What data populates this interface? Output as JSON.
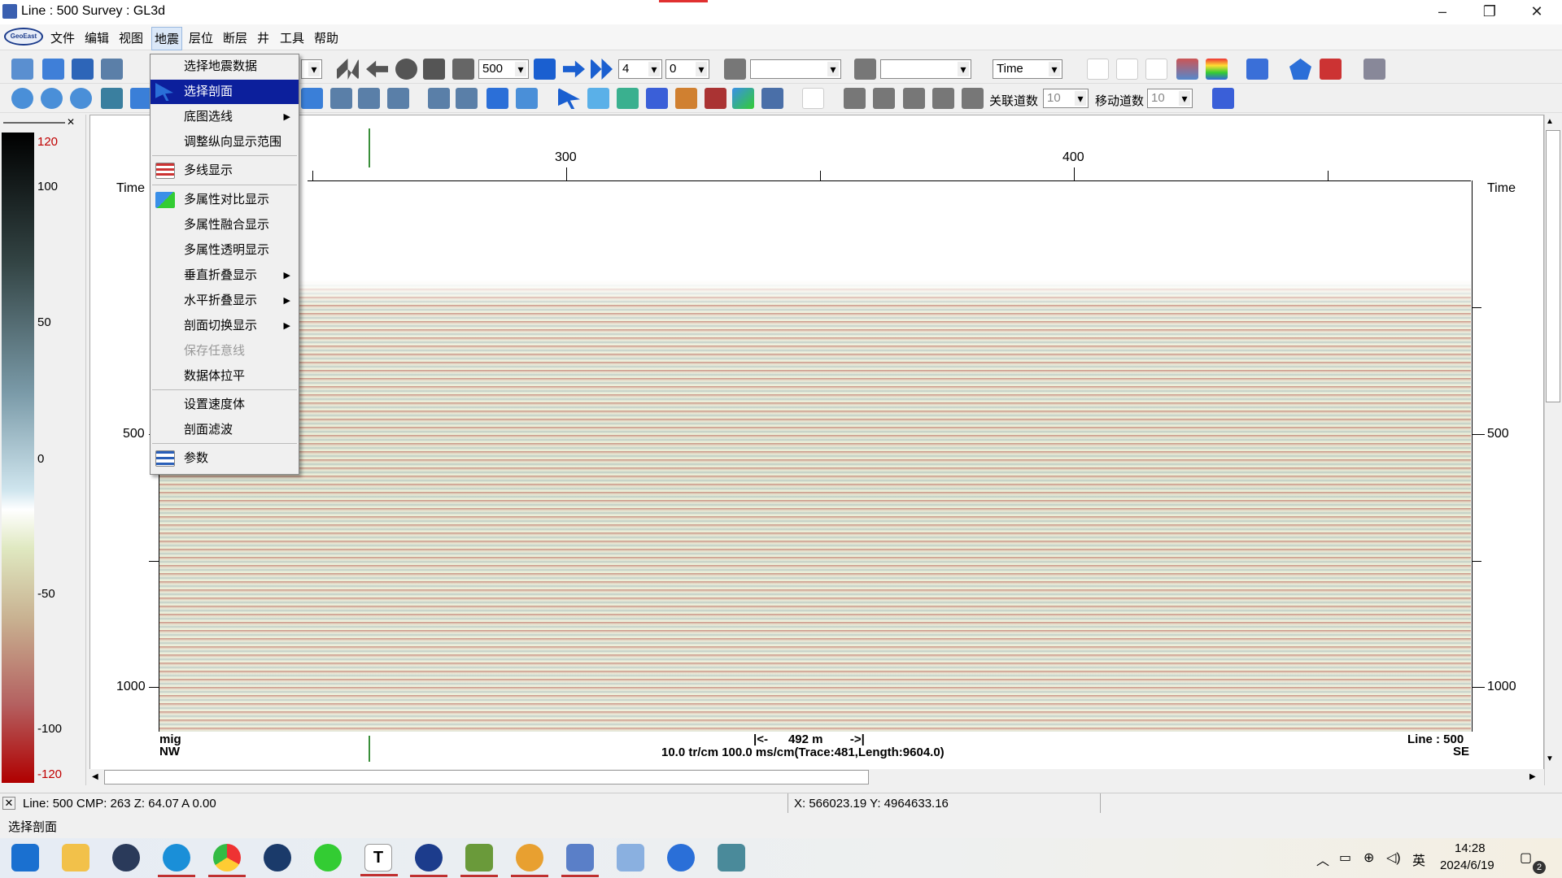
{
  "window": {
    "title": "Line : 500  Survey : GL3d"
  },
  "menu": {
    "logo_text": "GeoEast",
    "items": [
      "文件",
      "编辑",
      "视图",
      "地震",
      "层位",
      "断层",
      "井",
      "工具",
      "帮助"
    ],
    "active": "地震"
  },
  "dropdown": {
    "items": [
      {
        "label": "选择地震数据",
        "state": "normal",
        "submenu": false
      },
      {
        "label": "选择剖面",
        "state": "selected",
        "submenu": false
      },
      {
        "label": "底图选线",
        "state": "normal",
        "submenu": true
      },
      {
        "label": "调整纵向显示范围",
        "state": "normal",
        "submenu": false
      },
      {
        "label": "多线显示",
        "state": "normal",
        "submenu": false
      },
      {
        "label": "多属性对比显示",
        "state": "normal",
        "submenu": false
      },
      {
        "label": "多属性融合显示",
        "state": "normal",
        "submenu": false
      },
      {
        "label": "多属性透明显示",
        "state": "normal",
        "submenu": false
      },
      {
        "label": "垂直折叠显示",
        "state": "normal",
        "submenu": true
      },
      {
        "label": "水平折叠显示",
        "state": "normal",
        "submenu": true
      },
      {
        "label": "剖面切换显示",
        "state": "normal",
        "submenu": true
      },
      {
        "label": "保存任意线",
        "state": "disabled",
        "submenu": false
      },
      {
        "label": "数据体拉平",
        "state": "normal",
        "submenu": false
      },
      {
        "label": "设置速度体",
        "state": "normal",
        "submenu": false
      },
      {
        "label": "剖面滤波",
        "state": "normal",
        "submenu": false
      },
      {
        "label": "参数",
        "state": "normal",
        "submenu": false
      }
    ]
  },
  "toolbar1": {
    "line_value": "500",
    "step_value": "4",
    "offset_value": "0",
    "domain_value": "Time"
  },
  "toolbar2": {
    "assoc_label": "关联道数",
    "assoc_value": "10",
    "move_label": "移动道数",
    "move_value": "10"
  },
  "colorbar": {
    "ticks": [
      "120",
      "100",
      "50",
      "0",
      "-50",
      "-100",
      "-120"
    ]
  },
  "plot": {
    "time_label_left": "Time",
    "time_label_right": "Time",
    "x_ticks": [
      "300",
      "400"
    ],
    "y_ticks_left": [
      "500",
      "1000"
    ],
    "y_ticks_right": [
      "500",
      "1000"
    ],
    "bottom_left_1": "mig",
    "bottom_left_2": "NW",
    "scale_bar": "|<-      492 m        ->|",
    "scale_info": "10.0 tr/cm 100.0 ms/cm(Trace:481,Length:9604.0)",
    "bottom_right_1": "Line : 500",
    "bottom_right_2": "SE"
  },
  "status": {
    "left": "Line:  500  CMP:  263  Z: 64.07  A  0.00",
    "coords": "X: 566023.19  Y: 4964633.16",
    "hint": "选择剖面"
  },
  "taskbar": {
    "time": "14:28",
    "date": "2024/6/19",
    "ime": "英",
    "notif_count": "2"
  },
  "colors": {
    "selection": "#0c1f9c",
    "accent": "#1c3c8c"
  }
}
